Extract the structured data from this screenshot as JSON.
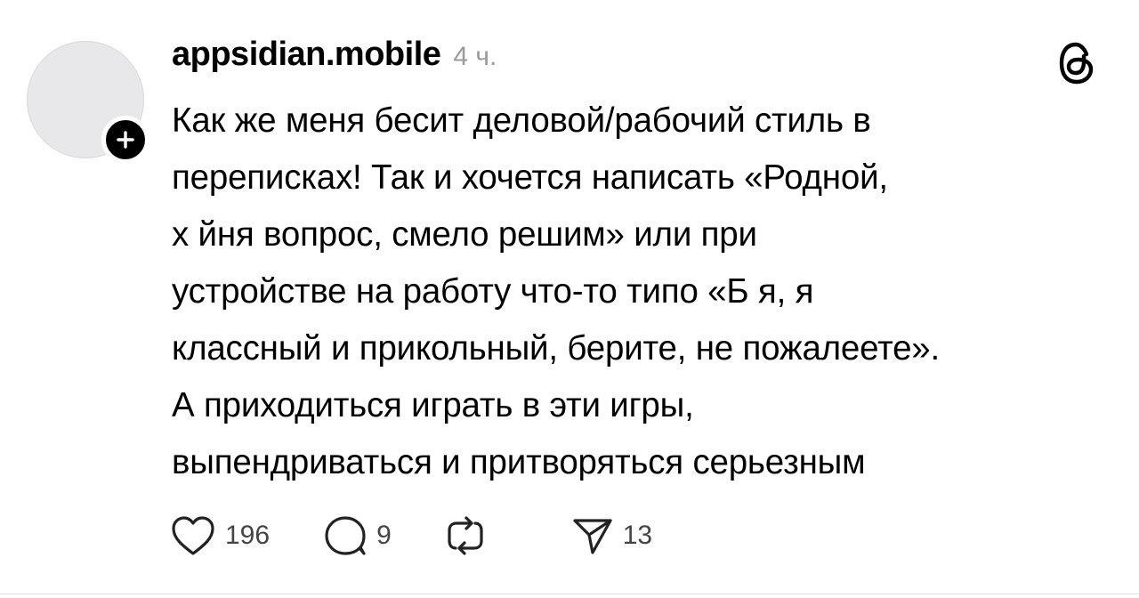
{
  "post": {
    "username": "appsidian.mobile",
    "time": "4 ч.",
    "body_lines": [
      "Как же меня бесит деловой/рабочий стиль в",
      "переписках! Так и хочется написать «Родной,",
      "х  йня вопрос, смело решим» или при",
      "устройстве на работу что-то типо «Б  я, я",
      "классный и прикольный, берите, не пожалеете».",
      "А приходиться играть в эти игры,",
      "выпендриваться и притворяться серьезным"
    ],
    "actions": {
      "likes": "196",
      "replies": "9",
      "reposts": "",
      "shares": "13"
    }
  },
  "icons": {
    "avatar": "avatar-placeholder",
    "follow": "plus-icon",
    "app_logo": "threads-logo-icon",
    "like": "heart-icon",
    "reply": "comment-bubble-icon",
    "repost": "repost-arrows-icon",
    "share": "send-paper-plane-icon"
  },
  "colors": {
    "text": "#000000",
    "muted": "#9a9a9a",
    "avatar_bg": "#e8e8ea"
  }
}
